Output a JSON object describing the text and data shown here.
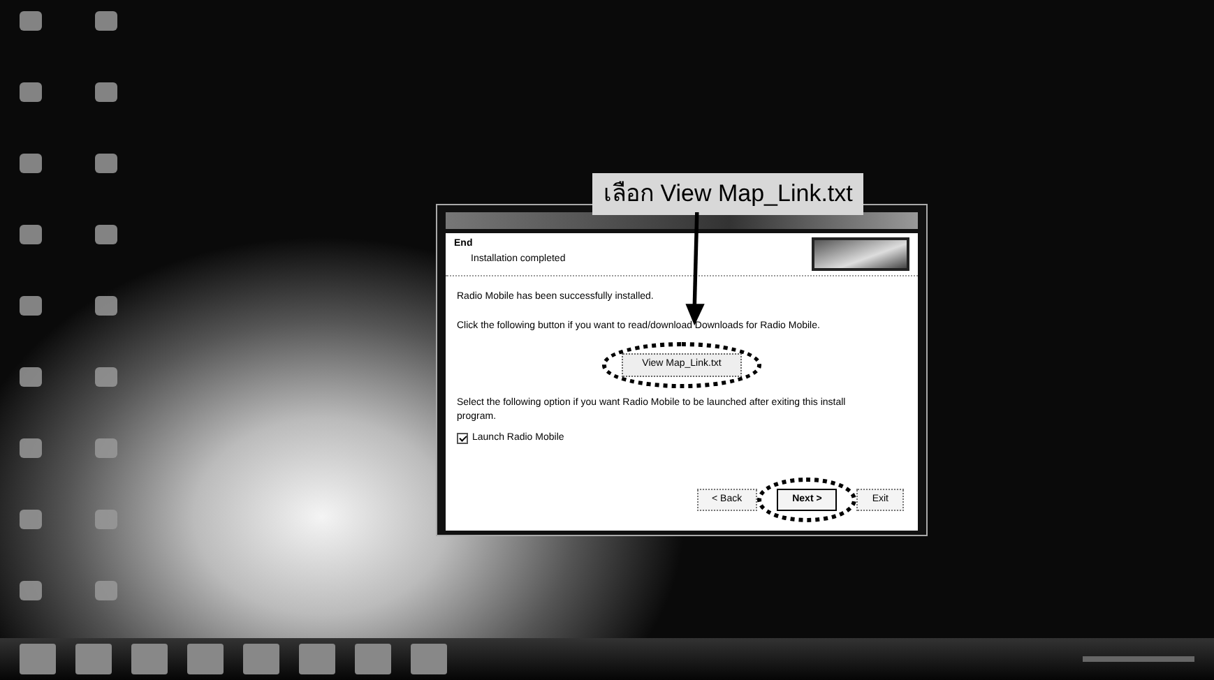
{
  "annotation": {
    "label": "เลือก View Map_Link.txt"
  },
  "dialog": {
    "heading": "End",
    "subheading": "Installation completed",
    "message": "Radio Mobile has been successfully installed.",
    "prompt": "Click the following button if you want to read/download Downloads for Radio Mobile.",
    "link_button": {
      "label": "View Map_Link.txt",
      "circled": true
    },
    "option_text": "Select the following option if you want Radio Mobile to be launched after exiting this install program.",
    "checkbox": {
      "label": "Launch Radio Mobile",
      "checked": true
    },
    "buttons": [
      {
        "label": "< Back",
        "circled": false
      },
      {
        "label": "Next >",
        "circled": true
      },
      {
        "label": "Exit",
        "circled": false
      }
    ]
  }
}
